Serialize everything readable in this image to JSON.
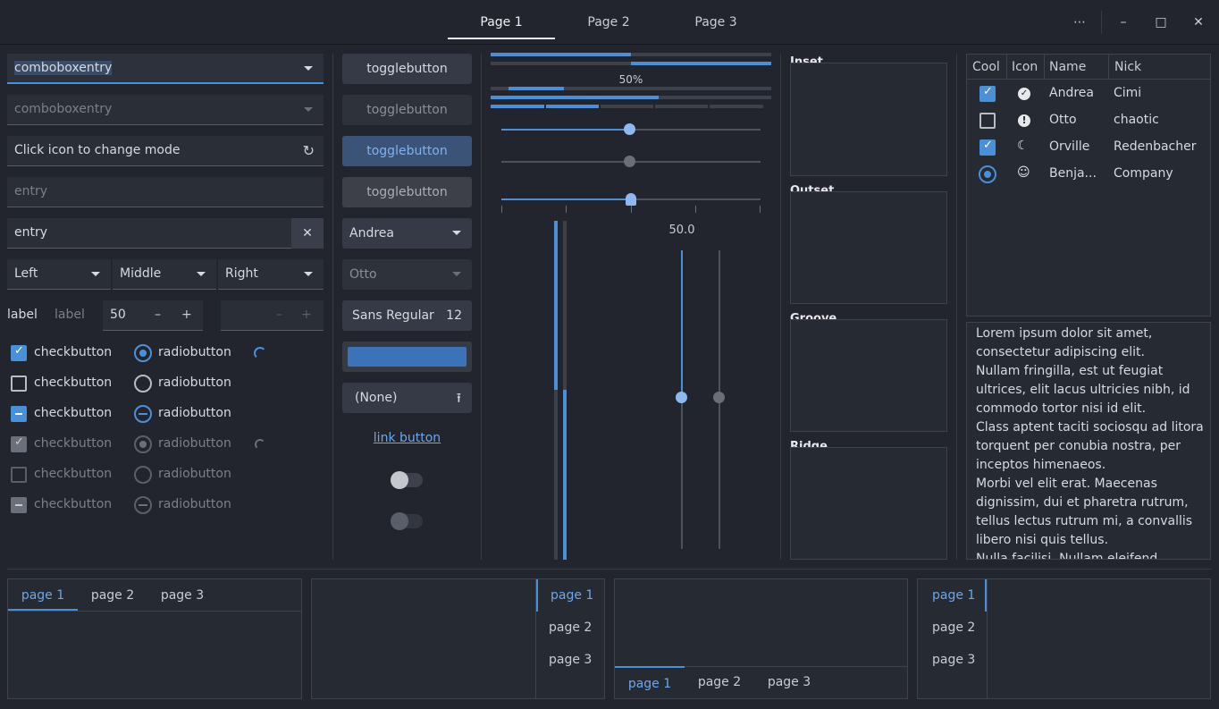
{
  "header": {
    "tabs": [
      "Page 1",
      "Page 2",
      "Page 3"
    ],
    "menu_glyph": "⋯",
    "minimize_glyph": "–",
    "maximize_glyph": "□",
    "close_glyph": "✕"
  },
  "col1": {
    "combo1": "comboboxentry",
    "combo2": "comboboxentry",
    "mode_entry": "Click icon to change mode",
    "entry_placeholder": "entry",
    "entry_value": "entry",
    "clear_glyph": "✕",
    "combos": [
      "Left",
      "Middle",
      "Right"
    ],
    "label1": "label",
    "label2": "label",
    "spin_value": "50",
    "minus": "–",
    "plus": "+",
    "check_label": "checkbutton",
    "radio_label": "radiobutton"
  },
  "col2": {
    "toggle_label": "togglebutton",
    "combo_andrea": "Andrea",
    "combo_otto": "Otto",
    "font_name": "Sans Regular",
    "font_size": "12",
    "file_label": "(None)",
    "link_label": "link button"
  },
  "col3": {
    "progress_text": "50%",
    "scale_value": "50.0",
    "progress_top": 0.5,
    "scale_h1": 0.5,
    "scale_h2": 0.5,
    "scale_h3": 0.5,
    "scale_v": 0.5
  },
  "frames": [
    "Inset",
    "Outset",
    "Groove",
    "Ridge"
  ],
  "tree": {
    "headers": [
      "Cool",
      "Icon",
      "Name",
      "Nick"
    ],
    "rows": [
      {
        "name": "Andrea",
        "nick": "Cimi",
        "icon": "check-circle-icon"
      },
      {
        "name": "Otto",
        "nick": "chaotic",
        "icon": "warning-icon"
      },
      {
        "name": "Orville",
        "nick": "Redenbacher",
        "icon": "moon-face-icon"
      },
      {
        "name": "Benja...",
        "nick": "Company",
        "icon": "face-icon"
      }
    ]
  },
  "textview": {
    "lines": [
      "Lorem ipsum dolor sit amet,",
      "consectetur adipiscing elit.",
      "Nullam fringilla, est ut feugiat",
      "ultrices, elit lacus ultricies nibh, id",
      "commodo tortor nisi id elit.",
      "Class aptent taciti sociosqu ad litora",
      "torquent per conubia nostra, per",
      "inceptos himenaeos.",
      "Morbi vel elit erat. Maecenas",
      "dignissim, dui et pharetra rutrum,",
      "tellus lectus rutrum mi, a convallis",
      "libero nisi quis tellus.",
      "Nulla facilisi. Nullam eleifend"
    ]
  },
  "notebooks": {
    "tabs": [
      "page 1",
      "page 2",
      "page 3"
    ]
  },
  "colors": {
    "accent": "#4a90d9",
    "background": "#22252d"
  }
}
